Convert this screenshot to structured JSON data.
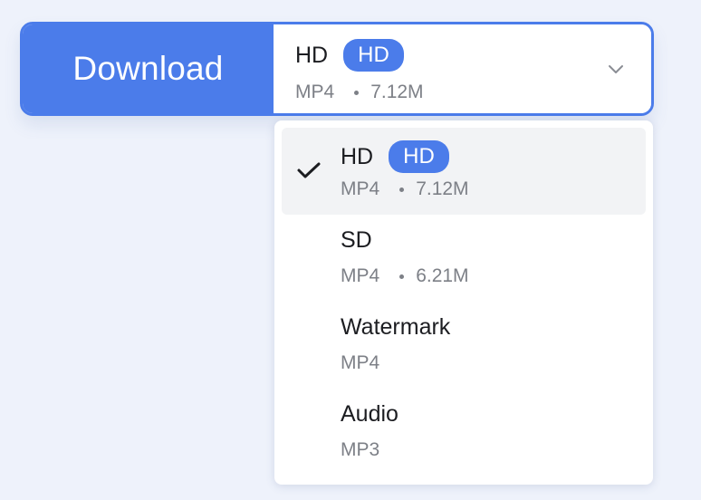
{
  "download_button": {
    "label": "Download"
  },
  "selected": {
    "quality": "HD",
    "badge": "HD",
    "format": "MP4",
    "size": "7.12M"
  },
  "options": [
    {
      "label": "HD",
      "badge": "HD",
      "format": "MP4",
      "size": "7.12M",
      "selected": true
    },
    {
      "label": "SD",
      "format": "MP4",
      "size": "6.21M",
      "selected": false
    },
    {
      "label": "Watermark",
      "format": "MP4",
      "selected": false
    },
    {
      "label": "Audio",
      "format": "MP3",
      "selected": false
    }
  ],
  "colors": {
    "accent": "#4b7cea",
    "muted_text": "#7d8087",
    "selected_bg": "#f2f3f5"
  },
  "icons": {
    "selector": "chevron-down-icon",
    "selected_option": "checkmark-icon"
  }
}
